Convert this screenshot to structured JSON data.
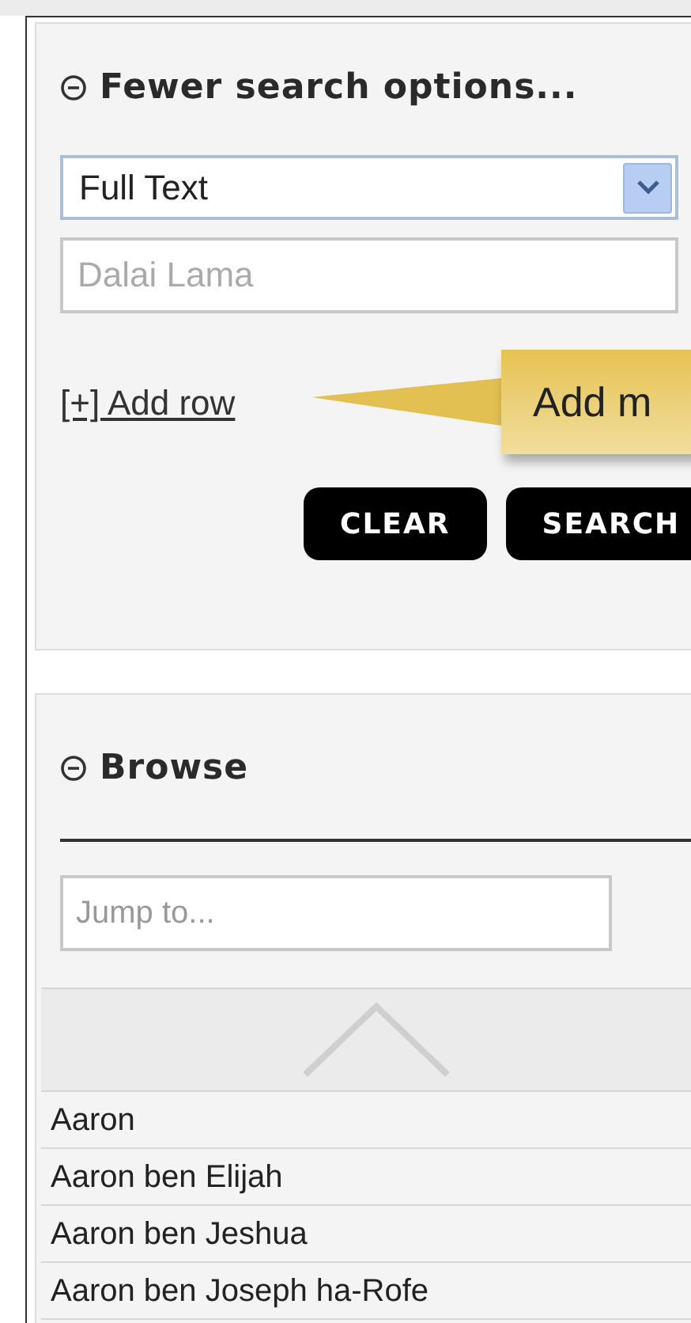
{
  "search_panel": {
    "title": "Fewer search options...",
    "field_select": {
      "value": "Full Text"
    },
    "query": {
      "placeholder": "Dalai Lama"
    },
    "add_row": "[+] Add row",
    "tooltip": "Add m",
    "buttons": [
      "CLEAR",
      "SEARCH"
    ]
  },
  "browse_panel": {
    "title": "Browse",
    "jump": {
      "placeholder": "Jump to..."
    },
    "items": [
      "Aaron",
      "Aaron ben Elijah",
      "Aaron ben Jeshua",
      "Aaron ben Joseph ha-Rofe"
    ]
  }
}
